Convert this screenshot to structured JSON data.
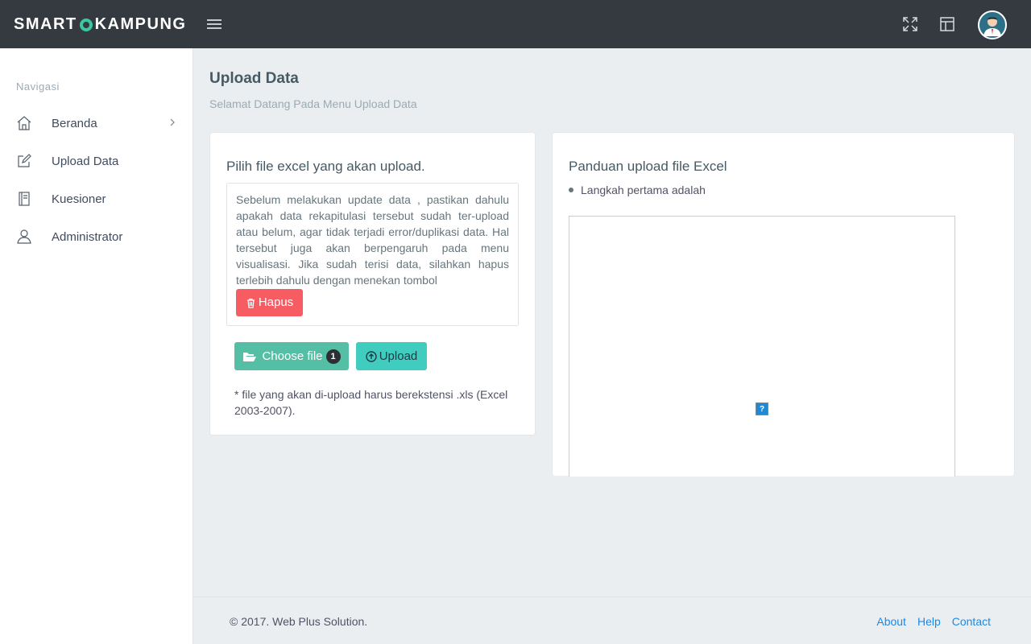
{
  "brand": {
    "left": "SMART",
    "right": "KAMPUNG"
  },
  "topbar": {
    "icons": [
      "fullscreen-icon",
      "layout-icon"
    ],
    "avatar": "user-avatar"
  },
  "sidebar": {
    "header": "Navigasi",
    "items": [
      {
        "label": "Beranda",
        "icon": "home-icon",
        "has_submenu": true
      },
      {
        "label": "Upload Data",
        "icon": "edit-icon",
        "has_submenu": false
      },
      {
        "label": "Kuesioner",
        "icon": "book-icon",
        "has_submenu": false
      },
      {
        "label": "Administrator",
        "icon": "user-icon",
        "has_submenu": false
      }
    ]
  },
  "page": {
    "title": "Upload Data",
    "subtitle": "Selamat Datang Pada Menu Upload Data"
  },
  "upload_card": {
    "title": "Pilih file excel yang akan upload.",
    "notice": "Sebelum melakukan update data , pastikan dahulu apakah data rekapitulasi tersebut sudah ter-upload atau belum, agar tidak terjadi error/duplikasi data. Hal tersebut juga akan berpengaruh pada menu visualisasi. Jika sudah terisi data, silahkan hapus terlebih dahulu dengan menekan tombol",
    "delete_label": "Hapus",
    "choose_label": "Choose file",
    "choose_badge": "1",
    "upload_label": "Upload",
    "note": "* file yang akan di-upload harus berekstensi .xls (Excel 2003-2007)."
  },
  "guide_card": {
    "title": "Panduan upload file Excel",
    "step": "Langkah pertama adalah",
    "broken_image_glyph": "?"
  },
  "footer": {
    "copyright": "© 2017. Web Plus Solution.",
    "links": [
      "About",
      "Help",
      "Contact"
    ]
  },
  "colors": {
    "topbar": "#343a40",
    "accent": "#3cc7a3",
    "danger": "#f75c63",
    "choose": "#55bfa6",
    "upload": "#40cdc0",
    "link": "#1e88e5"
  }
}
